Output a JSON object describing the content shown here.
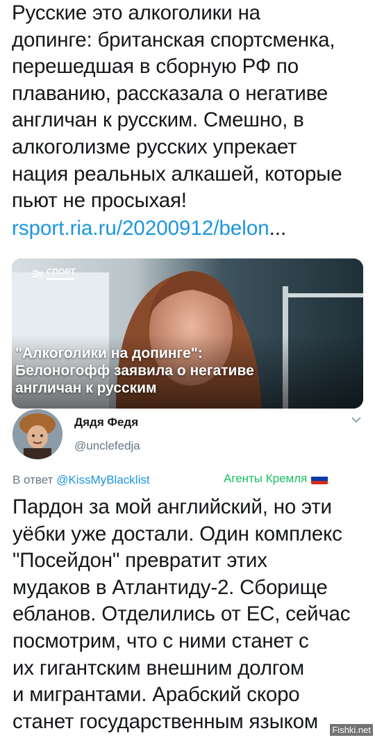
{
  "tweet": {
    "lines": [
      "Русские это алкоголики на",
      "допинге: британская спортсменка,",
      "перешедшая в сборную РФ по",
      "плаванию, рассказала о негативе",
      "англичан к русским. Смешно, в",
      "алкоголизме русских упрекает",
      "нация реальных алкашей, которые",
      "пьют не просыхая!"
    ],
    "link": "rsport.ria.ru/20200912/belon",
    "link_ellipsis": "..."
  },
  "card": {
    "logo_text": "СПОРТ",
    "headline": [
      "\"Алкоголики на допинге\":",
      "Белоногофф заявила о негативе",
      "англичан к русским"
    ]
  },
  "reply": {
    "name": "Дядя Федя",
    "handle": "@unclefedja",
    "reply_prefix": "В ответ",
    "reply_mention": "@KissMyBlacklist",
    "location": "Агенты Кремля",
    "lines": [
      "Пардон за мой английский, но эти",
      "уёбки уже достали. Один комплекс",
      "\"Посейдон\" превратит этих",
      "мудаков в Атлантиду-2. Сборище",
      "ебланов. Отделились от ЕС, сейчас",
      "посмотрим, что с ними станет с",
      "их гигантским внешним долгом",
      "и мигрантами. Арабский скоро",
      "станет государственным языком"
    ]
  },
  "watermark": "Fishki.net",
  "colors": {
    "link": "#1b95e0",
    "location": "#17bf63",
    "muted": "#657786"
  }
}
